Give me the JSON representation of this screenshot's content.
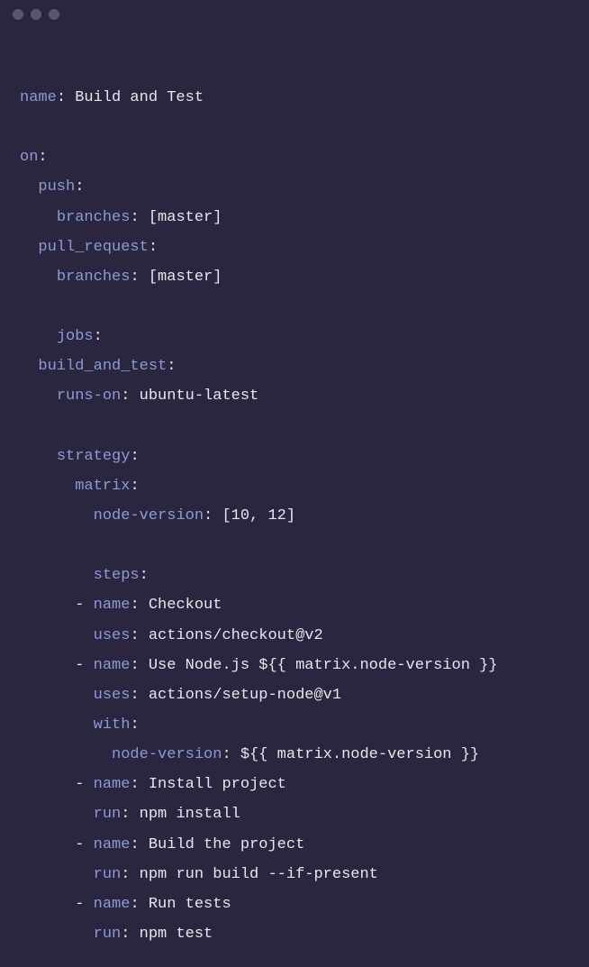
{
  "lines": [
    {
      "tokens": [
        {
          "t": "name",
          "c": "key"
        },
        {
          "t": ": ",
          "c": "punct"
        },
        {
          "t": "Build and Test",
          "c": "val"
        }
      ]
    },
    {
      "tokens": []
    },
    {
      "tokens": [
        {
          "t": "on",
          "c": "key"
        },
        {
          "t": ":",
          "c": "punct"
        }
      ]
    },
    {
      "tokens": [
        {
          "t": "  ",
          "c": "val"
        },
        {
          "t": "push",
          "c": "key"
        },
        {
          "t": ":",
          "c": "punct"
        }
      ]
    },
    {
      "tokens": [
        {
          "t": "    ",
          "c": "val"
        },
        {
          "t": "branches",
          "c": "key"
        },
        {
          "t": ": [master]",
          "c": "punct"
        }
      ]
    },
    {
      "tokens": [
        {
          "t": "  ",
          "c": "val"
        },
        {
          "t": "pull_request",
          "c": "key"
        },
        {
          "t": ":",
          "c": "punct"
        }
      ]
    },
    {
      "tokens": [
        {
          "t": "    ",
          "c": "val"
        },
        {
          "t": "branches",
          "c": "key"
        },
        {
          "t": ": [master]",
          "c": "punct"
        }
      ]
    },
    {
      "tokens": []
    },
    {
      "tokens": [
        {
          "t": "    ",
          "c": "val"
        },
        {
          "t": "jobs",
          "c": "key"
        },
        {
          "t": ":",
          "c": "punct"
        }
      ]
    },
    {
      "tokens": [
        {
          "t": "  ",
          "c": "val"
        },
        {
          "t": "build_and_test",
          "c": "key"
        },
        {
          "t": ":",
          "c": "punct"
        }
      ]
    },
    {
      "tokens": [
        {
          "t": "    ",
          "c": "val"
        },
        {
          "t": "runs-on",
          "c": "key"
        },
        {
          "t": ": ubuntu-latest",
          "c": "punct"
        }
      ]
    },
    {
      "tokens": []
    },
    {
      "tokens": [
        {
          "t": "    ",
          "c": "val"
        },
        {
          "t": "strategy",
          "c": "key"
        },
        {
          "t": ":",
          "c": "punct"
        }
      ]
    },
    {
      "tokens": [
        {
          "t": "      ",
          "c": "val"
        },
        {
          "t": "matrix",
          "c": "key"
        },
        {
          "t": ":",
          "c": "punct"
        }
      ]
    },
    {
      "tokens": [
        {
          "t": "        ",
          "c": "val"
        },
        {
          "t": "node-version",
          "c": "key"
        },
        {
          "t": ": [10, 12]",
          "c": "punct"
        }
      ]
    },
    {
      "tokens": []
    },
    {
      "tokens": [
        {
          "t": "        ",
          "c": "val"
        },
        {
          "t": "steps",
          "c": "key"
        },
        {
          "t": ":",
          "c": "punct"
        }
      ]
    },
    {
      "tokens": [
        {
          "t": "      - ",
          "c": "punct"
        },
        {
          "t": "name",
          "c": "key"
        },
        {
          "t": ": Checkout",
          "c": "punct"
        }
      ]
    },
    {
      "tokens": [
        {
          "t": "        ",
          "c": "val"
        },
        {
          "t": "uses",
          "c": "key"
        },
        {
          "t": ": actions/checkout@v2",
          "c": "punct"
        }
      ]
    },
    {
      "tokens": [
        {
          "t": "      - ",
          "c": "punct"
        },
        {
          "t": "name",
          "c": "key"
        },
        {
          "t": ": Use Node.js ${{ matrix.node-version }}",
          "c": "punct"
        }
      ]
    },
    {
      "tokens": [
        {
          "t": "        ",
          "c": "val"
        },
        {
          "t": "uses",
          "c": "key"
        },
        {
          "t": ": actions/setup-node@v1",
          "c": "punct"
        }
      ]
    },
    {
      "tokens": [
        {
          "t": "        ",
          "c": "val"
        },
        {
          "t": "with",
          "c": "key"
        },
        {
          "t": ":",
          "c": "punct"
        }
      ]
    },
    {
      "tokens": [
        {
          "t": "          ",
          "c": "val"
        },
        {
          "t": "node-version",
          "c": "key"
        },
        {
          "t": ": ${{ matrix.node-version }}",
          "c": "punct"
        }
      ]
    },
    {
      "tokens": [
        {
          "t": "      - ",
          "c": "punct"
        },
        {
          "t": "name",
          "c": "key"
        },
        {
          "t": ": Install project",
          "c": "punct"
        }
      ]
    },
    {
      "tokens": [
        {
          "t": "        ",
          "c": "val"
        },
        {
          "t": "run",
          "c": "key"
        },
        {
          "t": ": npm install",
          "c": "punct"
        }
      ]
    },
    {
      "tokens": [
        {
          "t": "      - ",
          "c": "punct"
        },
        {
          "t": "name",
          "c": "key"
        },
        {
          "t": ": Build the project",
          "c": "punct"
        }
      ]
    },
    {
      "tokens": [
        {
          "t": "        ",
          "c": "val"
        },
        {
          "t": "run",
          "c": "key"
        },
        {
          "t": ": npm run build --if-present",
          "c": "punct"
        }
      ]
    },
    {
      "tokens": [
        {
          "t": "      - ",
          "c": "punct"
        },
        {
          "t": "name",
          "c": "key"
        },
        {
          "t": ": Run tests",
          "c": "punct"
        }
      ]
    },
    {
      "tokens": [
        {
          "t": "        ",
          "c": "val"
        },
        {
          "t": "run",
          "c": "key"
        },
        {
          "t": ": npm test",
          "c": "punct"
        }
      ]
    }
  ]
}
